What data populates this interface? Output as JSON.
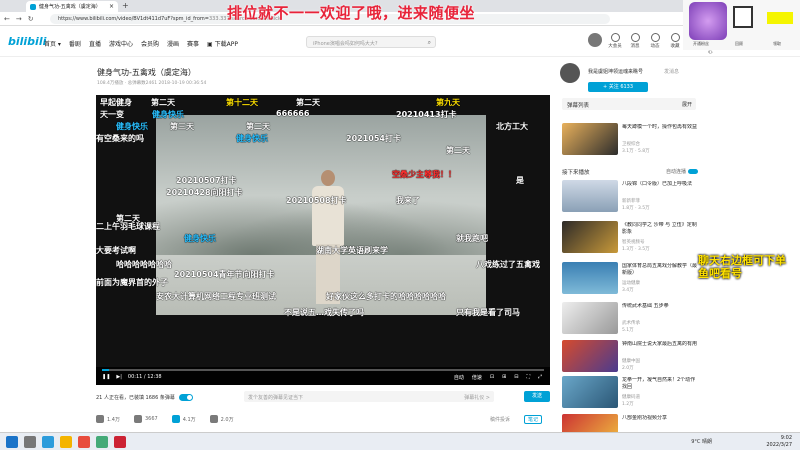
{
  "browser": {
    "tab_title": "健身气功-五禽戏（虞定海）",
    "url_main": "https://www.bilibili.com/video/BV1dt411d7uF?spm_id_from=",
    "url_rest": "333.337.search-card.all.click",
    "win_controls": [
      "—",
      "☐",
      "✕"
    ]
  },
  "header": {
    "logo": "bilibili",
    "nav": [
      "首页 ▾",
      "番剧",
      "直播",
      "游戏中心",
      "会员购",
      "漫画",
      "赛事",
      "▣ 下载APP"
    ],
    "search_placeholder": "iPhone演唱会吗如何吗大大?",
    "icons": [
      "大会员",
      "消息",
      "动态",
      "收藏",
      "历史",
      "创作中心"
    ]
  },
  "overlay_title": "排位就不一一欢迎了哦，进来随便坐",
  "side_sticker_lines": [
    "聊天右边框可下单",
    "鱼吧看号"
  ],
  "video": {
    "title": "健身气功-五禽戏（虞定海）",
    "meta": "108.4万播放 · 总弹幕数2461  2018-10-19 00:36:54",
    "time": "00:11 / 12:38",
    "progress": 0.015,
    "controls_right": [
      "自动",
      "倍速",
      "⊡",
      "⊞",
      "⊟",
      "⛶",
      "⤢"
    ]
  },
  "danmaku": [
    {
      "text": "早起健身",
      "c": "w"
    },
    {
      "text": "第二天",
      "c": "w"
    },
    {
      "text": "第十二天",
      "c": "y"
    },
    {
      "text": "第二天",
      "c": "w"
    },
    {
      "text": "第九天",
      "c": "y"
    },
    {
      "text": "天一变",
      "c": "w"
    },
    {
      "text": "健身快乐",
      "c": "b"
    },
    {
      "text": "666666",
      "c": "w"
    },
    {
      "text": "20210413打卡",
      "c": "w"
    },
    {
      "text": "北方工大",
      "c": "w"
    },
    {
      "text": "健身快乐",
      "c": "b"
    },
    {
      "text": "第三天",
      "c": "w"
    },
    {
      "text": "第二天",
      "c": "w"
    },
    {
      "text": "有空桑来的吗",
      "c": "w"
    },
    {
      "text": "健身快乐",
      "c": "b"
    },
    {
      "text": "2021054打卡",
      "c": "w"
    },
    {
      "text": "第二天",
      "c": "w"
    },
    {
      "text": "空桑少主尊我！！",
      "c": "r"
    },
    {
      "text": "20210428向阳打卡",
      "c": "w"
    },
    {
      "text": "是",
      "c": "w"
    },
    {
      "text": "20210508打卡",
      "c": "w"
    },
    {
      "text": "第二天",
      "c": "w"
    },
    {
      "text": "二上午羽毛球课程",
      "c": "w"
    },
    {
      "text": "就我跑吧",
      "c": "w"
    },
    {
      "text": "健身快乐",
      "c": "b"
    },
    {
      "text": "大要考试啊",
      "c": "w"
    },
    {
      "text": "湖南大学英语刷来学",
      "c": "w"
    },
    {
      "text": "哈哈哈哈哈哈哈",
      "c": "w"
    },
    {
      "text": "20210504青年节向阳打卡",
      "c": "w"
    },
    {
      "text": "八戏练过了五禽戏",
      "c": "w"
    },
    {
      "text": "安农大计算机网络工程专业班测试",
      "c": "w"
    },
    {
      "text": "好家伙这么多打卡的哈哈哈哈哈哈",
      "c": "w"
    },
    {
      "text": "不是说五…戏失传了吗",
      "c": "w"
    },
    {
      "text": "只有我是看了司马",
      "c": "w"
    },
    {
      "text": "前面为魔界首的外子",
      "c": "w"
    },
    {
      "text": "20210507打卡",
      "c": "w"
    },
    {
      "text": "我来了",
      "c": "w"
    }
  ],
  "danmaku_bar": {
    "count": "21 人正在看，已装填 1686 条弹幕",
    "placeholder": "发个友善的弹幕见证当下",
    "etiquette": "弹幕礼仪 >",
    "send": "发送"
  },
  "actions": {
    "like": "1.4万",
    "coin": "3667",
    "fav": "4.1万",
    "share": "2.0万",
    "report": "稿件投诉",
    "note": "笔记"
  },
  "uploader": {
    "name": "我是虞姐坤领运魂来瞧号",
    "msg": "发消息",
    "follow": "+ 关注 6133"
  },
  "dm_list": {
    "label": "弹幕列表",
    "more": "展开"
  },
  "next": {
    "label": "接下来播放",
    "autoplay": "自动连播"
  },
  "recs": [
    {
      "title": "每天蹲模一个时，操作包再有效益",
      "up": "卫视综合",
      "views": "3.1万 · 5.8万"
    },
    {
      "title": "八段锦（口令版）已加上呼吸法",
      "up": "新新菲菲",
      "views": "1.8万 · 3.5万"
    },
    {
      "title": "《教同同学之 沙带 与 立伍》定制影象",
      "up": "智英视频号",
      "views": "1.3万 · 3.5万"
    },
    {
      "title": "国家体育总局五禽戏分解教学（最新版）",
      "up": "运动健康",
      "views": "3.4万"
    },
    {
      "title": "传统武术基础 五步拳",
      "up": "武术传承",
      "views": "5.1万"
    },
    {
      "title": "钟南山院士说大家最后五禽的有用",
      "up": "健康中国",
      "views": "2.0万"
    },
    {
      "title": "龙拳一开，凝气自然来！2个动作找回",
      "up": "健康码道",
      "views": "1.2万"
    },
    {
      "title": "八部金刚功视频分享",
      "up": "",
      "views": ""
    }
  ],
  "corner_widget": {
    "labels": [
      "开通粉丝",
      "回顾",
      "领取"
    ]
  },
  "taskbar": {
    "weather": "9°C 晴朗",
    "time": "9:02",
    "date": "2022/3/27"
  }
}
